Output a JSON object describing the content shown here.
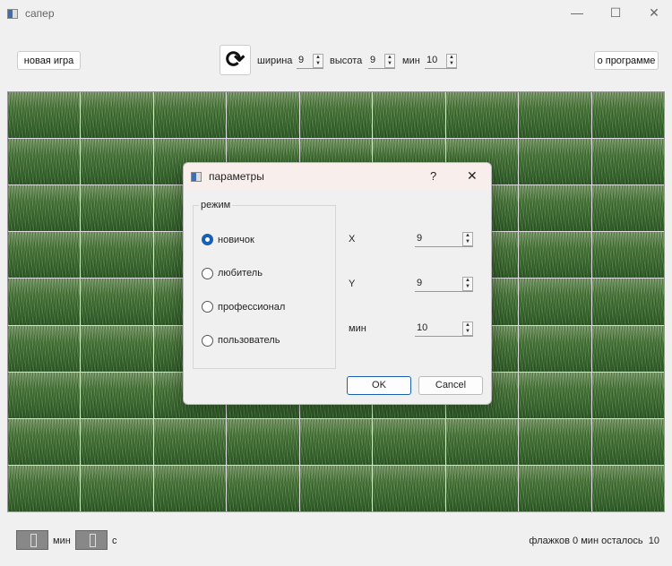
{
  "window": {
    "title": "сапер",
    "icon": "app-icon",
    "controls": [
      "minimize-icon",
      "maximize-icon",
      "close-icon"
    ]
  },
  "toolbar": {
    "new_game": "новая игра",
    "refresh_icon": "refresh-icon",
    "width_label": "ширина",
    "width_value": "9",
    "height_label": "высота",
    "height_value": "9",
    "mines_label": "мин",
    "mines_value": "10",
    "about": "о программе"
  },
  "board": {
    "rows": 9,
    "cols": 9,
    "cell_texture": "grass"
  },
  "status": {
    "timer_min": "0",
    "min_label": "мин",
    "timer_sec": "0",
    "sec_label": "с",
    "flags_label": "флажков",
    "flags_value": "0",
    "mines_left_label": "мин осталось",
    "mines_left_value": "10"
  },
  "dialog": {
    "title": "параметры",
    "help": "?",
    "close": "✕",
    "group_title": "режим",
    "modes": [
      {
        "label": "новичок",
        "selected": true
      },
      {
        "label": "любитель",
        "selected": false
      },
      {
        "label": "профессионал",
        "selected": false
      },
      {
        "label": "пользователь",
        "selected": false
      }
    ],
    "fields": [
      {
        "label": "X",
        "value": "9"
      },
      {
        "label": "Y",
        "value": "9"
      },
      {
        "label": "мин",
        "value": "10"
      }
    ],
    "ok": "OK",
    "cancel": "Cancel",
    "accent": "#1a5fb4"
  }
}
